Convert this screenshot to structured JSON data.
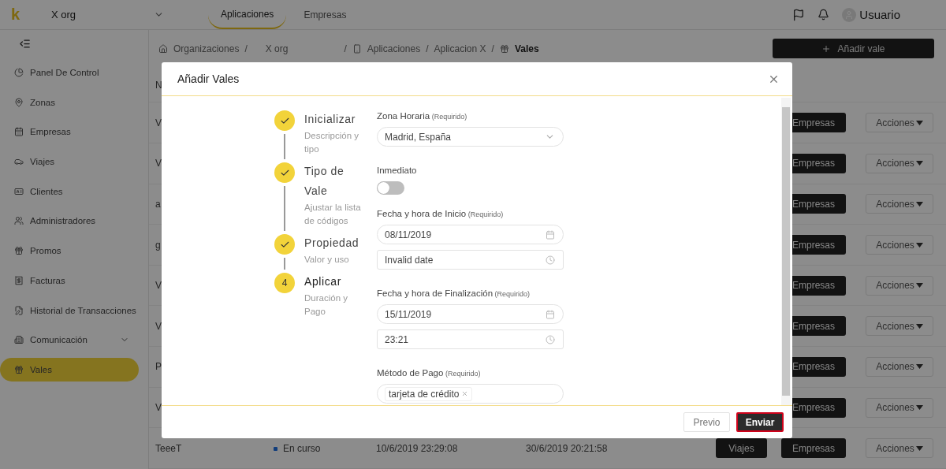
{
  "topbar": {
    "logo": "k",
    "org": "X org",
    "tabs": [
      {
        "label": "Aplicaciones",
        "selected": true
      },
      {
        "label": "Empresas",
        "selected": false
      }
    ],
    "user": "Usuario"
  },
  "sidebar": {
    "items": [
      {
        "label": "Panel De Control",
        "selected": false,
        "expandable": false
      },
      {
        "label": "Zonas",
        "selected": false,
        "expandable": false
      },
      {
        "label": "Empresas",
        "selected": false,
        "expandable": false
      },
      {
        "label": "Viajes",
        "selected": false,
        "expandable": false
      },
      {
        "label": "Clientes",
        "selected": false,
        "expandable": false
      },
      {
        "label": "Administradores",
        "selected": false,
        "expandable": false
      },
      {
        "label": "Promos",
        "selected": false,
        "expandable": false
      },
      {
        "label": "Facturas",
        "selected": false,
        "expandable": false
      },
      {
        "label": "Historial de Transacciones",
        "selected": false,
        "expandable": false
      },
      {
        "label": "Comunicación",
        "selected": false,
        "expandable": true
      },
      {
        "label": "Vales",
        "selected": true,
        "expandable": false
      }
    ]
  },
  "breadcrumb": [
    {
      "kind": "link",
      "label": "Organizaciones"
    },
    {
      "kind": "separator",
      "label": "/"
    },
    {
      "kind": "link",
      "label": "X org"
    },
    {
      "kind": "separator",
      "label": "/"
    },
    {
      "kind": "link",
      "label": "Aplicaciones"
    },
    {
      "kind": "separator",
      "label": "/"
    },
    {
      "kind": "link",
      "label": "Aplicacion X"
    },
    {
      "kind": "separator",
      "label": "/"
    },
    {
      "kind": "current",
      "label": "Vales"
    }
  ],
  "add_button": "Añadir vale",
  "table": {
    "header": [
      "N"
    ],
    "rows": [
      {
        "name": "V",
        "buttons": [
          "Empresas"
        ],
        "menu": "Acciones"
      },
      {
        "name": "V",
        "buttons": [
          "Empresas"
        ],
        "menu": "Acciones"
      },
      {
        "name": "a",
        "buttons": [
          "Empresas"
        ],
        "menu": "Acciones"
      },
      {
        "name": "g",
        "buttons": [
          "Empresas"
        ],
        "menu": "Acciones"
      },
      {
        "name": "V",
        "buttons": [
          "Empresas"
        ],
        "menu": "Acciones"
      },
      {
        "name": "V",
        "buttons": [
          "Empresas"
        ],
        "menu": "Acciones"
      },
      {
        "name": "P",
        "buttons": [
          "Empresas"
        ],
        "menu": "Acciones"
      },
      {
        "name": "V",
        "buttons": [
          "Empresas"
        ],
        "menu": "Acciones"
      },
      {
        "name": "TeeeT",
        "status": "En curso",
        "start": "10/6/2019 23:29:08",
        "end": "30/6/2019 20:21:58",
        "buttons": [
          "Viajes",
          "Empresas"
        ],
        "menu": "Acciones"
      }
    ]
  },
  "modal": {
    "title": "Añadir Vales",
    "steps": [
      {
        "done": true,
        "title": "Inicializar",
        "description": "Descripción y tipo"
      },
      {
        "done": true,
        "title": "Tipo de Vale",
        "description": "Ajustar la lista de códigos"
      },
      {
        "done": true,
        "title": "Propiedad",
        "description": "Valor y uso"
      },
      {
        "done": false,
        "number": "4",
        "title": "Aplicar",
        "description": "Duración y Pago"
      }
    ],
    "fields": [
      {
        "kind": "select",
        "label": "Zona Horaria",
        "note": "(Requirido)",
        "value": "Madrid, España"
      },
      {
        "kind": "switch",
        "label": "Inmediato",
        "on": false
      },
      {
        "kind": "datetime",
        "label": "Fecha y hora de Inicio",
        "note": "(Requirido)",
        "date": "08/11/2019",
        "time": "Invalid date"
      },
      {
        "kind": "datetime",
        "label": "Fecha y hora de Finalización",
        "note": "(Requirido)",
        "date": "15/11/2019",
        "time": "23:21"
      },
      {
        "kind": "tags",
        "label": "Método de Pago",
        "note": "(Requirido)",
        "tags": [
          "tarjeta de crédito"
        ]
      }
    ],
    "buttons": [
      {
        "label": "Previo",
        "kind": "secondary",
        "focused": false
      },
      {
        "label": "Enviar",
        "kind": "primary",
        "focused": true
      }
    ]
  }
}
